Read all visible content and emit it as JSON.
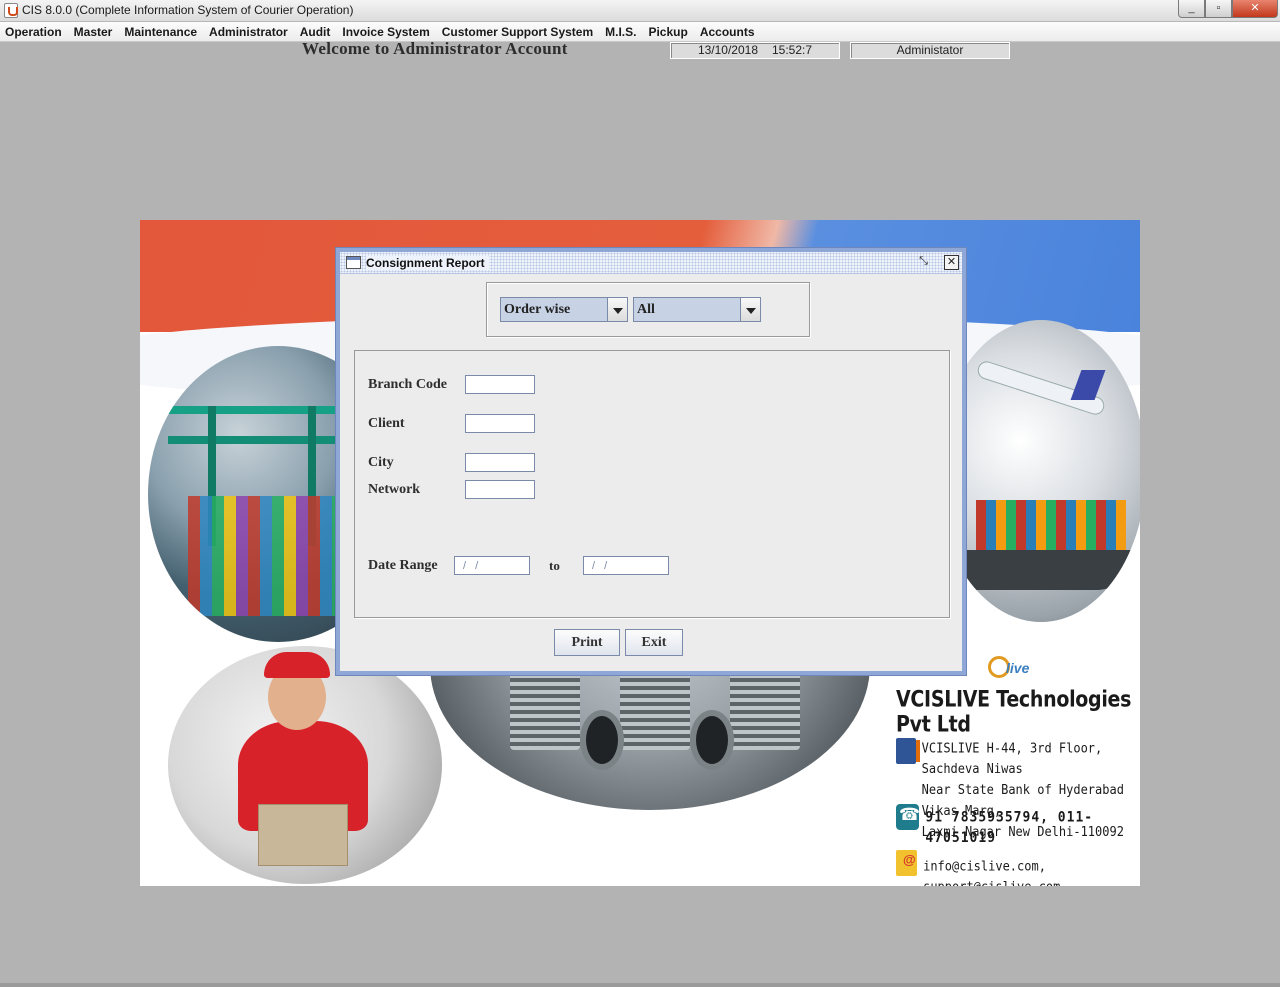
{
  "window": {
    "title": "CIS 8.0.0 (Complete Information System of Courier Operation)",
    "minimize": "_",
    "restore": "▫",
    "close": "✕"
  },
  "menu": [
    "Operation",
    "Master",
    "Maintenance",
    "Administrator",
    "Audit",
    "Invoice System",
    "Customer Support System",
    "M.I.S.",
    "Pickup",
    "Accounts"
  ],
  "header": {
    "welcome": "Welcome to Administrator Account",
    "date": "13/10/2018",
    "time": "15:52:7",
    "user": "Administator"
  },
  "company": {
    "logo_text": "live",
    "name": "VCISLIVE Technologies Pvt Ltd",
    "address_lines": [
      "VCISLIVE H-44, 3rd Floor, Sachdeva Niwas",
      "Near State Bank of Hyderabad Vikas Marg,",
      "Laxmi Nagar New Delhi-110092"
    ],
    "phone": "91 7835935794, 011-47051019",
    "email": "info@cislive.com, support@cislive.com"
  },
  "dialog": {
    "title": "Consignment Report",
    "restore_icon": "⤡",
    "close_icon": "✕",
    "order_combo": "Order wise",
    "filter_combo": "All",
    "labels": {
      "branch_code": "Branch Code",
      "client": "Client",
      "city": "City",
      "network": "Network",
      "date_range": "Date Range",
      "to": "to"
    },
    "fields": {
      "branch_code": "",
      "client": "",
      "city": "",
      "network": "",
      "date_from": "/ /",
      "date_to": "/ /"
    },
    "buttons": {
      "print": "Print",
      "exit": "Exit"
    }
  },
  "colors": {
    "banner_orange": "#e3573b",
    "banner_blue": "#4a83dc",
    "dialog_border": "#8fa7d6",
    "combo_fill": "#c7d2e4"
  }
}
